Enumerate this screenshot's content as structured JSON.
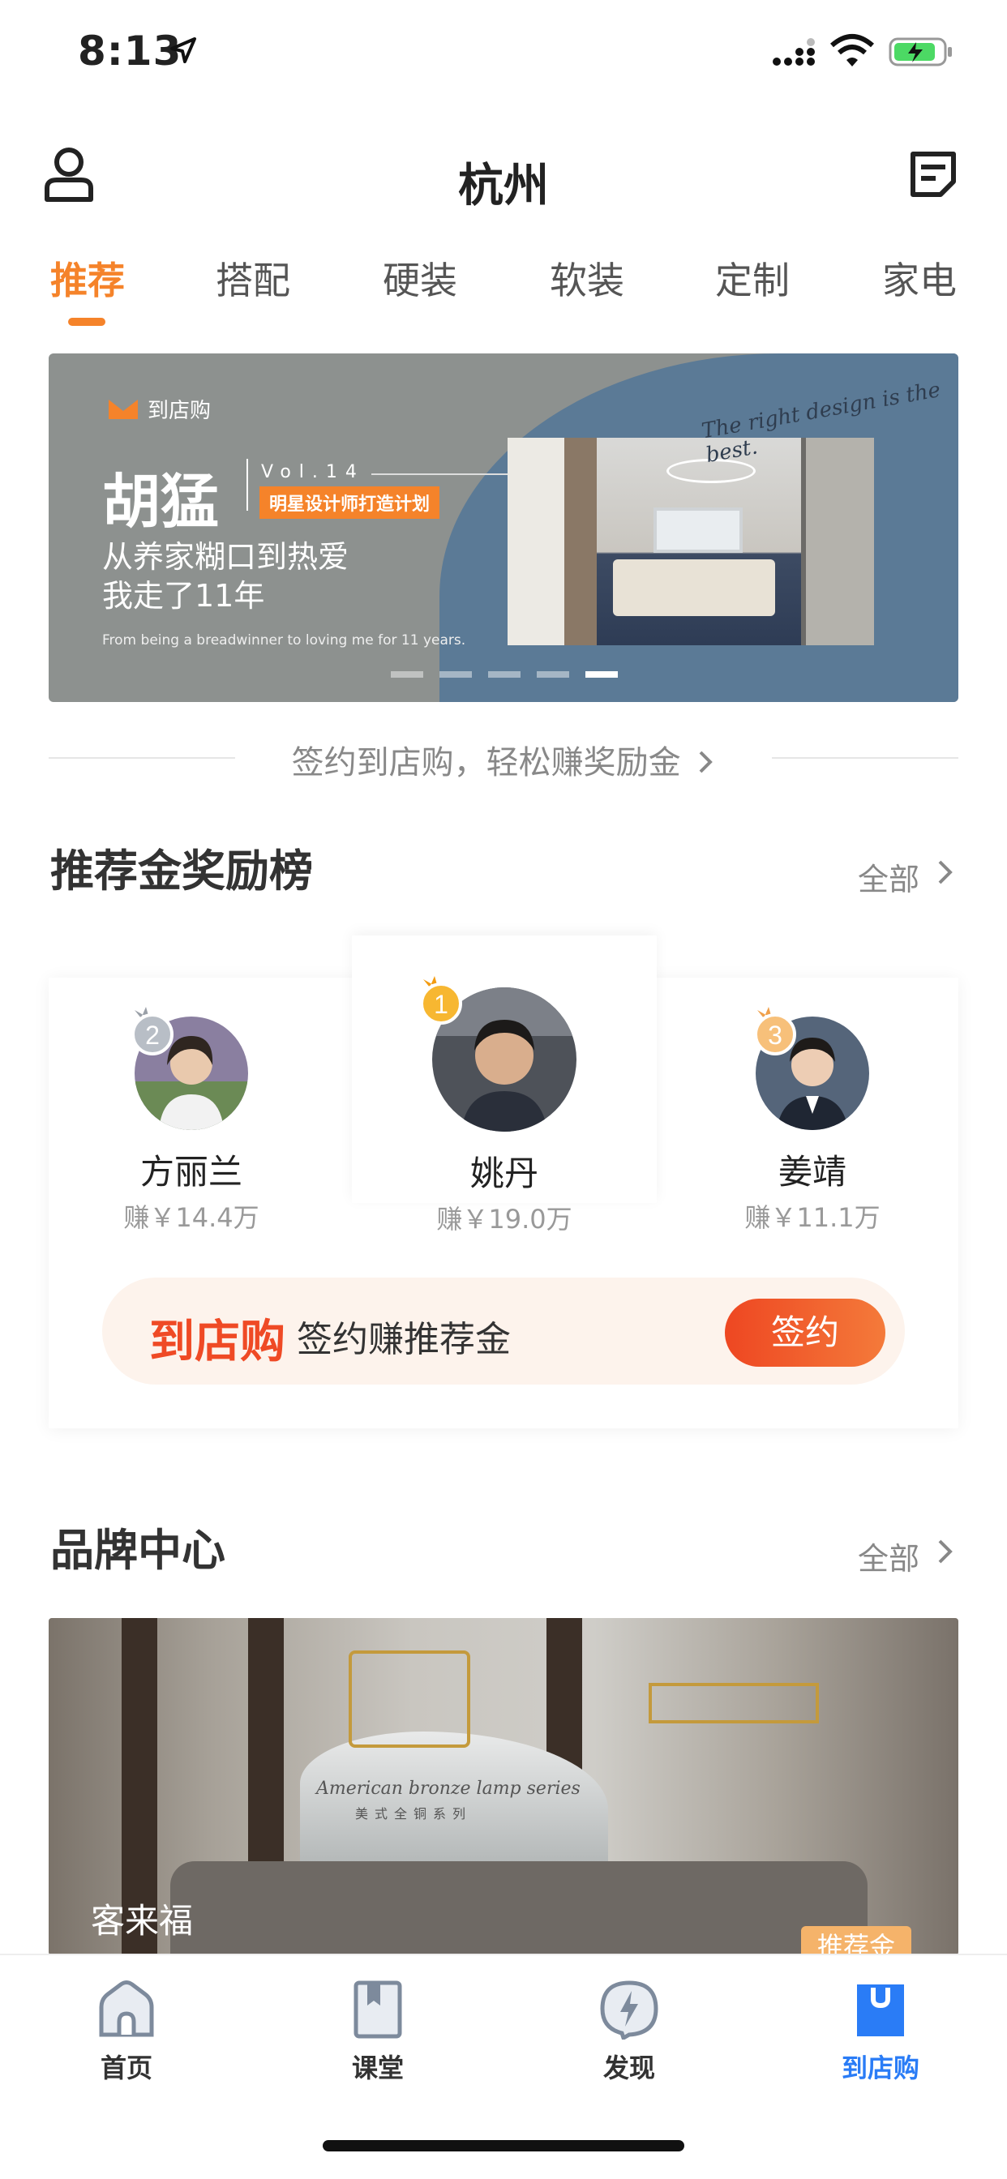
{
  "status_bar": {
    "time": "8:13"
  },
  "header": {
    "city": "杭州"
  },
  "tabs": [
    "推荐",
    "搭配",
    "硬装",
    "软装",
    "定制",
    "家电"
  ],
  "banner": {
    "brand": "到店购",
    "name": "胡猛",
    "vol": "Vol.14",
    "tag": "明星设计师打造计划",
    "line1": "从养家糊口到热爱",
    "line2": "我走了11年",
    "english": "From being a breadwinner to loving me for 11 years.",
    "tagline": "The right design is the best.",
    "slide_count": 5,
    "active_slide": 5
  },
  "sign_link": "签约到店购，轻松赚奖励金",
  "leaderboard": {
    "title": "推荐金奖励榜",
    "all_label": "全部",
    "rankers": [
      {
        "rank": "1",
        "name": "姚丹",
        "earn": "赚￥19.0万"
      },
      {
        "rank": "2",
        "name": "方丽兰",
        "earn": "赚￥14.4万"
      },
      {
        "rank": "3",
        "name": "姜靖",
        "earn": "赚￥11.1万"
      }
    ],
    "sign_bar": {
      "logo": "到店购",
      "text": "签约赚推荐金",
      "button": "签约"
    }
  },
  "brand_center": {
    "title": "品牌中心",
    "all_label": "全部",
    "card_label": "客来福",
    "script": "American bronze lamp series",
    "script_sub": "美式全铜系列",
    "badge": "推荐金"
  },
  "bottom_nav": [
    {
      "label": "首页",
      "icon": "home-icon"
    },
    {
      "label": "课堂",
      "icon": "book-icon"
    },
    {
      "label": "发现",
      "icon": "discover-icon"
    },
    {
      "label": "到店购",
      "icon": "shopping-bag-icon"
    }
  ],
  "colors": {
    "accent": "#f5832a",
    "sign_red": "#ef4a25",
    "nav_active": "#2a7cf6"
  }
}
